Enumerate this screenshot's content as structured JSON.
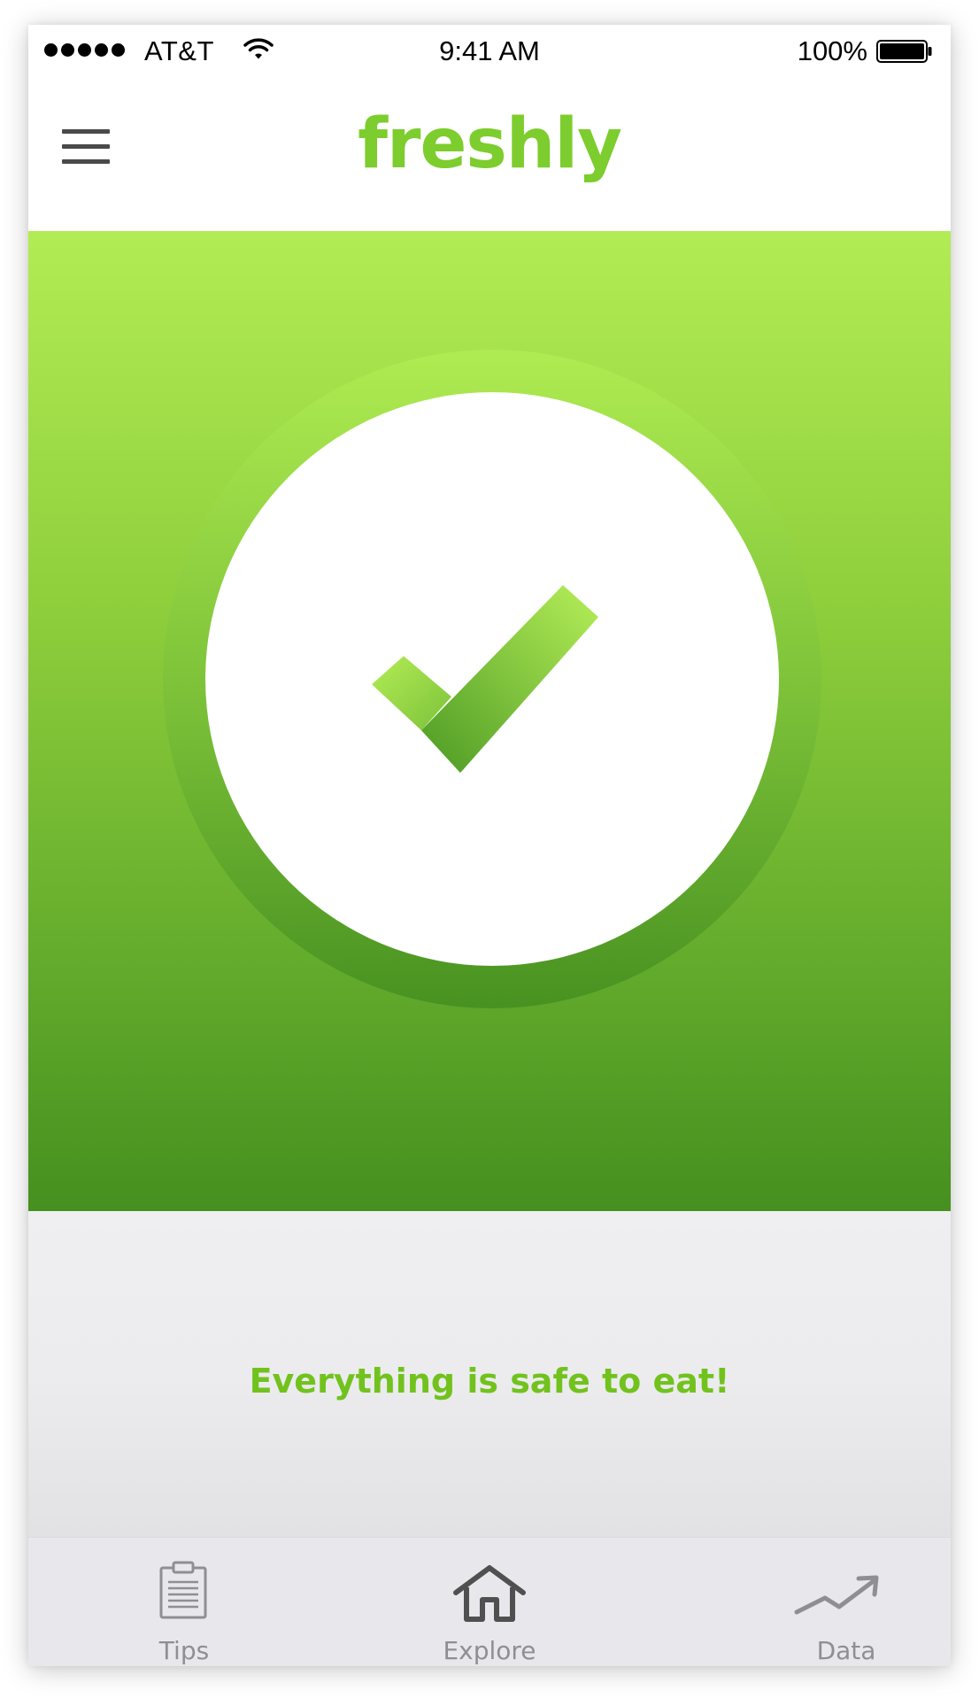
{
  "status_bar": {
    "carrier": "AT&T",
    "time": "9:41 AM",
    "battery_percent": "100%",
    "icons": [
      "signal-dots-icon",
      "wifi-icon",
      "battery-icon"
    ]
  },
  "header": {
    "title": "freshly",
    "menu_icon": "hamburger-menu-icon"
  },
  "hero": {
    "status_icon": "checkmark-icon"
  },
  "message": {
    "text": "Everything is safe to eat!"
  },
  "tabs": [
    {
      "label": "Tips",
      "icon": "clipboard-icon",
      "active": false
    },
    {
      "label": "Explore",
      "icon": "home-icon",
      "active": true
    },
    {
      "label": "Data",
      "icon": "trend-up-icon",
      "active": false
    }
  ],
  "colors": {
    "brand_green": "#7ccd2d",
    "message_green": "#72c21e",
    "hero_top": "#b2ec54",
    "hero_bottom": "#45901f",
    "tab_inactive": "#8e8e93",
    "tab_active_icon": "#505050"
  }
}
